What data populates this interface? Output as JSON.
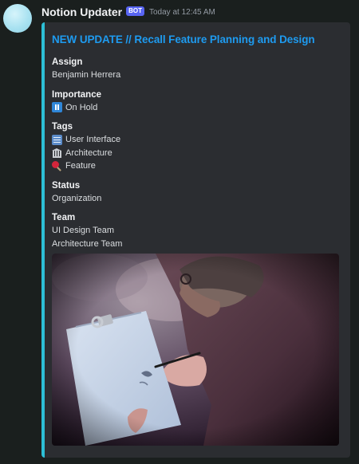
{
  "message": {
    "username": "Notion Updater",
    "bot_tag": "BOT",
    "timestamp": "Today at 12:45 AM"
  },
  "embed": {
    "title": "NEW UPDATE // Recall Feature Planning and Design",
    "accent_color": "#2dbfd6",
    "title_color": "#1e9bf0",
    "fields": {
      "assign": {
        "name": "Assign",
        "value": "Benjamin Herrera"
      },
      "importance": {
        "name": "Importance",
        "icon": "pause-button-icon",
        "value": "On Hold"
      },
      "tags": {
        "name": "Tags",
        "items": [
          {
            "icon": "bookmark-tabs-icon",
            "label": "User Interface"
          },
          {
            "icon": "classical-building-icon",
            "label": "Architecture"
          },
          {
            "icon": "magnifying-glass-icon",
            "label": "Feature"
          }
        ]
      },
      "status": {
        "name": "Status",
        "value": "Organization"
      },
      "team": {
        "name": "Team",
        "values": [
          "UI Design Team",
          "Architecture Team"
        ]
      }
    },
    "image": {
      "subject": "person-sketching-on-clipboard-photo"
    }
  }
}
